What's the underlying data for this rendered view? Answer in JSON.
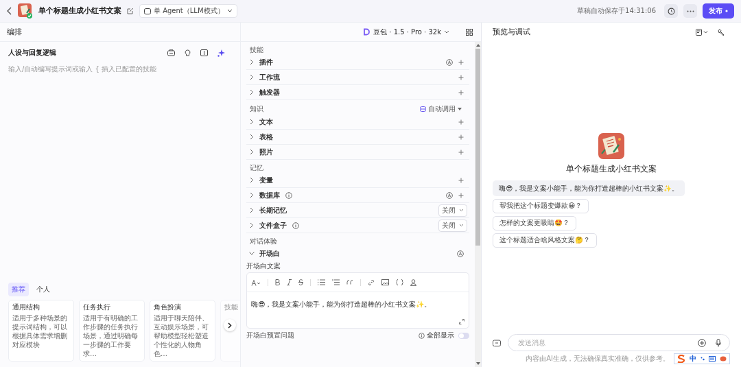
{
  "header": {
    "title": "单个标题生成小红书文案",
    "mode": "单 Agent（LLM模式）",
    "autosave": "草稿自动保存于14:31:06",
    "publish": "发布"
  },
  "editor": {
    "title": "编排",
    "model": "豆包 · 1.5 · Pro · 32k"
  },
  "persona": {
    "title": "人设与回复逻辑",
    "placeholder": "输入/自动编写提示词或输入 { 插入已配置的技能"
  },
  "templates": {
    "tabs": [
      {
        "label": "推荐",
        "selected": true
      },
      {
        "label": "个人",
        "selected": false
      }
    ],
    "cards": [
      {
        "title": "通用结构",
        "text": "适用于多种场景的提示词结构，可以根据具体需求增删对应模块"
      },
      {
        "title": "任务执行",
        "text": "适用于有明确的工作步骤的任务执行场景，通过明确每一步骤的工作要求…"
      },
      {
        "title": "角色扮演",
        "text": "适用于聊天陪伴、互动娱乐场景，可帮助模型轻松塑造个性化的人物角色…"
      },
      {
        "title": "技能"
      }
    ]
  },
  "sections": [
    {
      "title": "技能",
      "rows": [
        {
          "kind": "add",
          "label": "插件",
          "info": false,
          "auto": true,
          "expanded": false
        },
        {
          "kind": "add",
          "label": "工作流",
          "info": false,
          "auto": false,
          "expanded": false
        },
        {
          "kind": "add",
          "label": "触发器",
          "info": false,
          "auto": false,
          "expanded": false
        }
      ]
    },
    {
      "title": "知识",
      "mode": "自动调用",
      "rows": [
        {
          "kind": "add",
          "label": "文本",
          "info": false,
          "auto": false,
          "expanded": false
        },
        {
          "kind": "add",
          "label": "表格",
          "info": false,
          "auto": false,
          "expanded": false
        },
        {
          "kind": "add",
          "label": "照片",
          "info": false,
          "auto": false,
          "expanded": false
        }
      ]
    },
    {
      "title": "记忆",
      "rows": [
        {
          "kind": "add",
          "label": "变量",
          "info": false,
          "auto": false,
          "expanded": false
        },
        {
          "kind": "add",
          "label": "数据库",
          "info": true,
          "auto": true,
          "expanded": false
        },
        {
          "kind": "select",
          "label": "长期记忆",
          "info": false,
          "auto": false,
          "expanded": false,
          "value": "关闭"
        },
        {
          "kind": "select",
          "label": "文件盒子",
          "info": true,
          "auto": false,
          "expanded": false,
          "value": "关闭"
        }
      ]
    },
    {
      "title": "对话体验",
      "rows": [
        {
          "kind": "opening",
          "label": "开场白",
          "info": false,
          "auto": true,
          "expanded": true
        }
      ]
    }
  ],
  "opening": {
    "label": "开场白文案",
    "text": "嗨😎，我是文案小能手，能为你打造超棒的小红书文案✨。",
    "questions_label": "开场白预置问题",
    "show_all": "全部显示",
    "show_all_on": false
  },
  "preview": {
    "title": "预览与调试",
    "bot_name": "单个标题生成小红书文案",
    "greeting": "嗨😎，我是文案小能手，能为你打造超棒的小红书文案✨。",
    "suggestions": [
      "帮我把这个标题变爆款😀？",
      "怎样的文案更吸睛🤩？",
      "这个标题适合啥风格文案🤔？"
    ],
    "input_placeholder": "发送消息",
    "disclaimer": "内容由AI生成，无法确保真实准确，仅供参考。",
    "ime_mode": "中"
  }
}
